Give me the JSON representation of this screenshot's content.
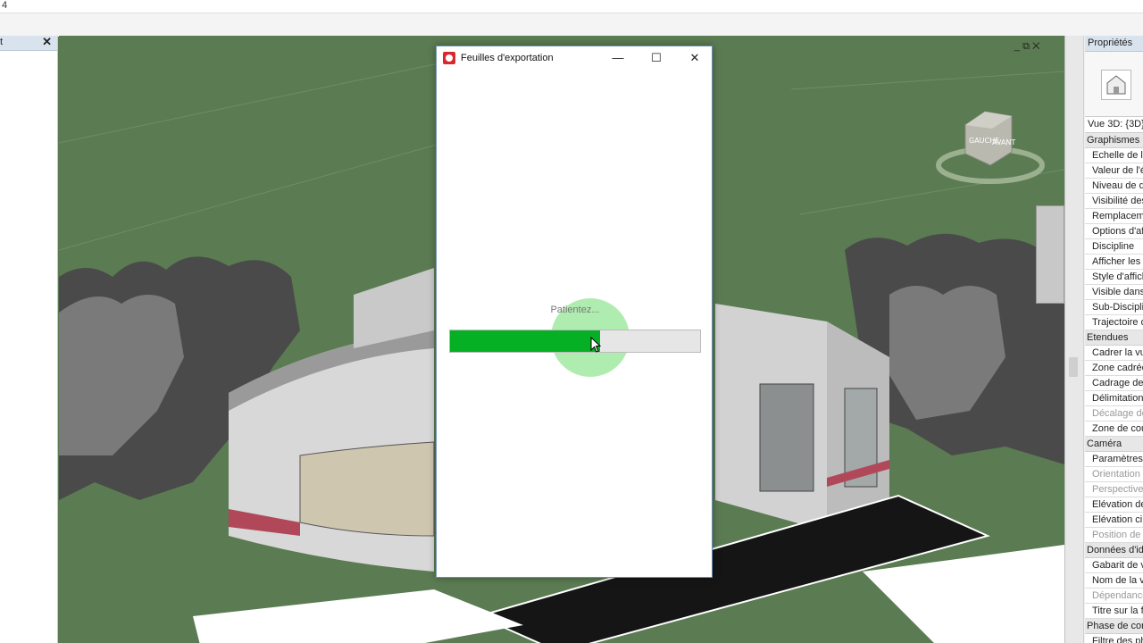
{
  "topbar": {
    "number": "4"
  },
  "left_panel": {
    "title": "t",
    "close": "✕"
  },
  "viewport": {
    "controls": "_ ⧉ ✕"
  },
  "dialog": {
    "title": "Feuilles d'exportation",
    "status": "Patientez...",
    "progress_fraction": 0.6,
    "minimize": "—",
    "maximize": "☐",
    "close": "✕"
  },
  "properties": {
    "title": "Propriétés",
    "view_selector": "Vue 3D: {3D}",
    "rows": [
      {
        "label": "Graphismes",
        "group": true
      },
      {
        "label": "Echelle de la"
      },
      {
        "label": "Valeur de l'é"
      },
      {
        "label": "Niveau de dé"
      },
      {
        "label": "Visibilité des"
      },
      {
        "label": "Remplacemen"
      },
      {
        "label": "Options d'affi"
      },
      {
        "label": "Discipline"
      },
      {
        "label": "Afficher les l"
      },
      {
        "label": "Style d'affich"
      },
      {
        "label": "Visible dans l"
      },
      {
        "label": "Sub-Discipline"
      },
      {
        "label": "Trajectoire d"
      },
      {
        "label": "Etendues",
        "group": true
      },
      {
        "label": "Cadrer la vue"
      },
      {
        "label": "Zone cadrée"
      },
      {
        "label": "Cadrage de l"
      },
      {
        "label": "Délimitation"
      },
      {
        "label": "Décalage de",
        "disabled": true
      },
      {
        "label": "Zone de cou"
      },
      {
        "label": "Caméra",
        "group": true
      },
      {
        "label": "Paramètres d"
      },
      {
        "label": "Orientation",
        "disabled": true
      },
      {
        "label": "Perspective",
        "disabled": true
      },
      {
        "label": "Elévation de"
      },
      {
        "label": "Elévation cib"
      },
      {
        "label": "Position de l",
        "disabled": true
      },
      {
        "label": "Données d'id",
        "group": true
      },
      {
        "label": "Gabarit de vu"
      },
      {
        "label": "Nom de la vu"
      },
      {
        "label": "Dépendance",
        "disabled": true
      },
      {
        "label": "Titre sur la f"
      },
      {
        "label": "Phase de con",
        "group": true
      },
      {
        "label": "Filtre des ph"
      }
    ]
  },
  "viewcube": {
    "face_left": "GAUCHE",
    "face_front": "AVANT"
  },
  "colors": {
    "progress": "#06b025",
    "ground": "#5b7b52"
  }
}
